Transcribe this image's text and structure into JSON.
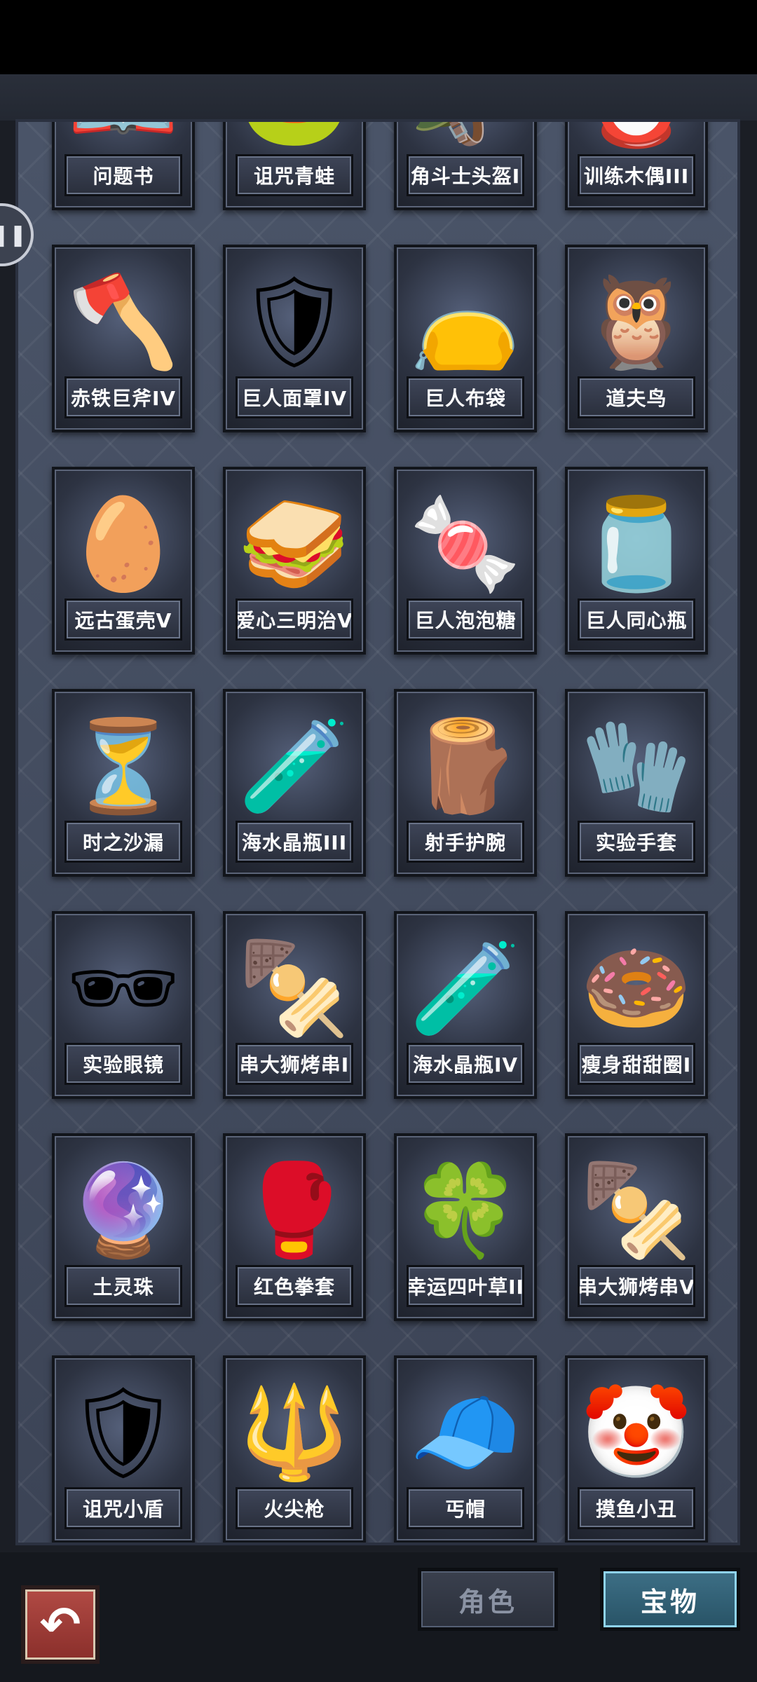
{
  "tabs": {
    "role": "角色",
    "treasure": "宝物"
  },
  "items": [
    {
      "name": "问题书",
      "icon": "📖"
    },
    {
      "name": "诅咒青蛙",
      "icon": "🐸"
    },
    {
      "name": "角斗士头盔I",
      "icon": "🪖"
    },
    {
      "name": "训练木偶III",
      "icon": "🪆"
    },
    {
      "name": "赤铁巨斧IV",
      "icon": "🪓"
    },
    {
      "name": "巨人面罩IV",
      "icon": "🛡"
    },
    {
      "name": "巨人布袋",
      "icon": "👝"
    },
    {
      "name": "道夫鸟",
      "icon": "🦉"
    },
    {
      "name": "远古蛋壳V",
      "icon": "🥚"
    },
    {
      "name": "爱心三明治V",
      "icon": "🥪"
    },
    {
      "name": "巨人泡泡糖",
      "icon": "🍬"
    },
    {
      "name": "巨人同心瓶",
      "icon": "🫙"
    },
    {
      "name": "时之沙漏",
      "icon": "⏳"
    },
    {
      "name": "海水晶瓶III",
      "icon": "🧪"
    },
    {
      "name": "射手护腕",
      "icon": "🪵"
    },
    {
      "name": "实验手套",
      "icon": "🧤"
    },
    {
      "name": "实验眼镜",
      "icon": "🕶"
    },
    {
      "name": "串大狮烤串I",
      "icon": "🍢"
    },
    {
      "name": "海水晶瓶IV",
      "icon": "🧪"
    },
    {
      "name": "瘦身甜甜圈I",
      "icon": "🍩"
    },
    {
      "name": "土灵珠",
      "icon": "🔮"
    },
    {
      "name": "红色拳套",
      "icon": "🥊"
    },
    {
      "name": "幸运四叶草II",
      "icon": "🍀"
    },
    {
      "name": "串大狮烤串V",
      "icon": "🍢"
    },
    {
      "name": "诅咒小盾",
      "icon": "🛡"
    },
    {
      "name": "火尖枪",
      "icon": "🔱"
    },
    {
      "name": "丐帽",
      "icon": "🧢"
    },
    {
      "name": "摸鱼小丑",
      "icon": "🤡"
    }
  ]
}
